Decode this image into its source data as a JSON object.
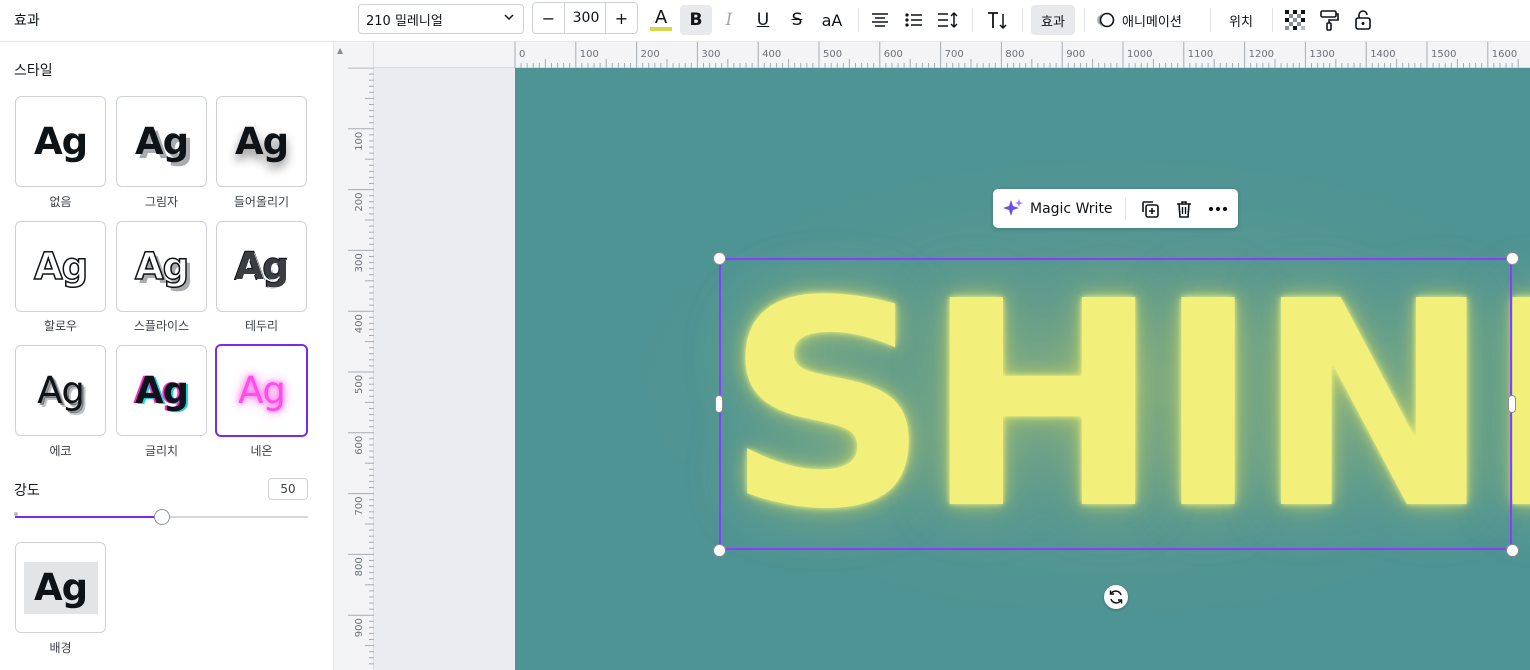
{
  "panel": {
    "title": "효과",
    "style_section_title": "스타일",
    "styles": [
      {
        "label": "없음",
        "preview": "Ag",
        "selected": false
      },
      {
        "label": "그림자",
        "preview": "Ag",
        "selected": false
      },
      {
        "label": "들어올리기",
        "preview": "Ag",
        "selected": false
      },
      {
        "label": "할로우",
        "preview": "Ag",
        "selected": false
      },
      {
        "label": "스플라이스",
        "preview": "Ag",
        "selected": false
      },
      {
        "label": "테두리",
        "preview": "Ag",
        "selected": false
      },
      {
        "label": "에코",
        "preview": "Ag",
        "selected": false
      },
      {
        "label": "글리치",
        "preview": "Ag",
        "selected": false
      },
      {
        "label": "네온",
        "preview": "Ag",
        "selected": true
      }
    ],
    "intensity": {
      "label": "강도",
      "value": "50",
      "percent": 50
    },
    "background_style": {
      "label": "배경",
      "preview": "Ag"
    }
  },
  "toolbar": {
    "font_name": "210 밀레니얼",
    "font_size": "300",
    "size_minus": "−",
    "size_plus": "+",
    "text_color_glyph": "A",
    "text_color": "#d8d64a",
    "bold": "B",
    "italic": "I",
    "underline": "U",
    "strikethrough": "S",
    "letter_case": "aA",
    "effects_label": "효과",
    "animation_label": "애니메이션",
    "position_label": "위치",
    "icons": [
      "align-center-icon",
      "list-icon",
      "line-spacing-icon",
      "text-direction-icon",
      "transparency-icon",
      "copy-style-icon",
      "lock-icon"
    ]
  },
  "ruler": {
    "top_labels": [
      "0",
      "100",
      "200",
      "300",
      "400",
      "500",
      "600",
      "700",
      "800",
      "900",
      "1000",
      "1100",
      "1200",
      "1300",
      "1400",
      "1500",
      "1600"
    ],
    "left_labels": [
      "100",
      "200",
      "300",
      "400",
      "500",
      "600",
      "700",
      "800",
      "900"
    ]
  },
  "canvas": {
    "background": "#4f9494",
    "text": "SHINE",
    "text_color": "#f3ef7b"
  },
  "floating_bar": {
    "magic_write_label": "Magic Write"
  },
  "accent_color": "#8b3dff"
}
